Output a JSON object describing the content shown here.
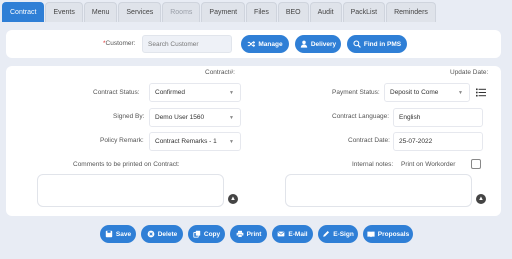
{
  "tabs": [
    {
      "label": "Contract",
      "active": true
    },
    {
      "label": "Events"
    },
    {
      "label": "Menu"
    },
    {
      "label": "Services"
    },
    {
      "label": "Rooms",
      "disabled": true
    },
    {
      "label": "Payment"
    },
    {
      "label": "Files"
    },
    {
      "label": "BEO"
    },
    {
      "label": "Audit"
    },
    {
      "label": "PackList"
    },
    {
      "label": "Reminders"
    }
  ],
  "customer": {
    "label": "*Customer:",
    "placeholder": "Search Customer",
    "manage_label": "Manage",
    "delivery_label": "Delivery",
    "find_label": "Find in PMS"
  },
  "contract": {
    "number_label": "Contract#:",
    "update_label": "Update Date:",
    "status_label": "Contract Status:",
    "status_value": "Confirmed",
    "signed_label": "Signed By:",
    "signed_value": "Demo User 1560",
    "policy_label": "Policy Remark:",
    "policy_value": "Contract Remarks - 1",
    "comments_label": "Comments to be printed on Contract:",
    "payment_label": "Payment Status:",
    "payment_value": "Deposit to Come",
    "language_label": "Contract Language:",
    "language_value": "English",
    "date_label": "Contract Date:",
    "date_value": "25-07-2022",
    "internal_label": "Internal notes:",
    "print_workorder_label": "Print on Workorder"
  },
  "actions": [
    {
      "label": "Save",
      "icon": "save-icon"
    },
    {
      "label": "Delete",
      "icon": "delete-icon"
    },
    {
      "label": "Copy",
      "icon": "copy-icon"
    },
    {
      "label": "Print",
      "icon": "print-icon"
    },
    {
      "label": "E-Mail",
      "icon": "email-icon"
    },
    {
      "label": "E-Sign",
      "icon": "pen-icon"
    },
    {
      "label": "Proposals",
      "icon": "proposals-icon"
    }
  ],
  "colors": {
    "accent": "#2f7fd6",
    "background": "#e8ecf4"
  }
}
